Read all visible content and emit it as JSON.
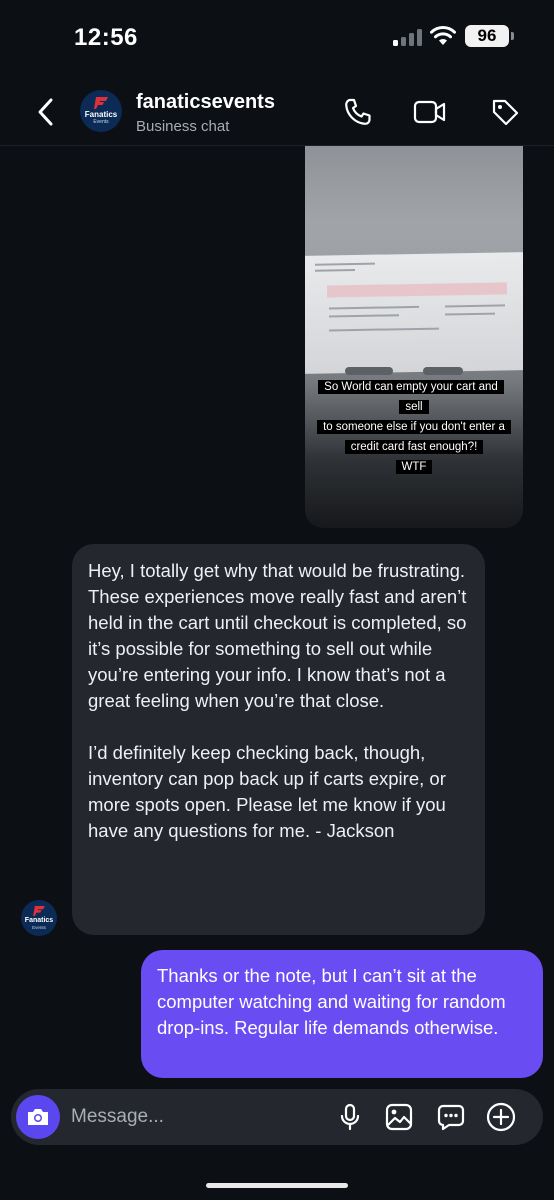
{
  "status_bar": {
    "time": "12:56",
    "battery": "96"
  },
  "header": {
    "title": "fanaticsevents",
    "subtitle": "Business chat",
    "avatar_brand": "Fanatics",
    "avatar_sub": "Events"
  },
  "media": {
    "caption_lines": [
      "So World can empty your cart and sell",
      "to someone else if you don't enter a",
      "credit card fast enough?!",
      "WTF"
    ]
  },
  "messages": {
    "incoming_p1": "Hey, I totally get why that would be frustrating. These experiences move really fast and aren’t held in the cart until checkout is completed, so it’s possible for something to sell out while you’re entering your info. I know that’s not a great feeling when you’re that close.",
    "incoming_p2": "I’d definitely keep checking back, though, inventory can pop back up if carts expire, or more spots open. Please let me know if you have any questions for me. - Jackson",
    "outgoing": "Thanks or the note, but I can’t sit at the computer watching and waiting for random drop-ins. Regular life demands otherwise."
  },
  "composer": {
    "placeholder": "Message..."
  },
  "icons": {
    "back": "chevron-left-icon",
    "call": "phone-icon",
    "video": "video-icon",
    "tag": "tag-icon",
    "camera": "camera-icon",
    "mic": "microphone-icon",
    "gallery": "image-icon",
    "sticker": "chat-bubble-icon",
    "add": "plus-circle-icon"
  },
  "colors": {
    "accent": "#6a4cf3",
    "incoming_bubble": "#24272d",
    "background": "#0c0f14",
    "brand_red": "#e0313a"
  }
}
